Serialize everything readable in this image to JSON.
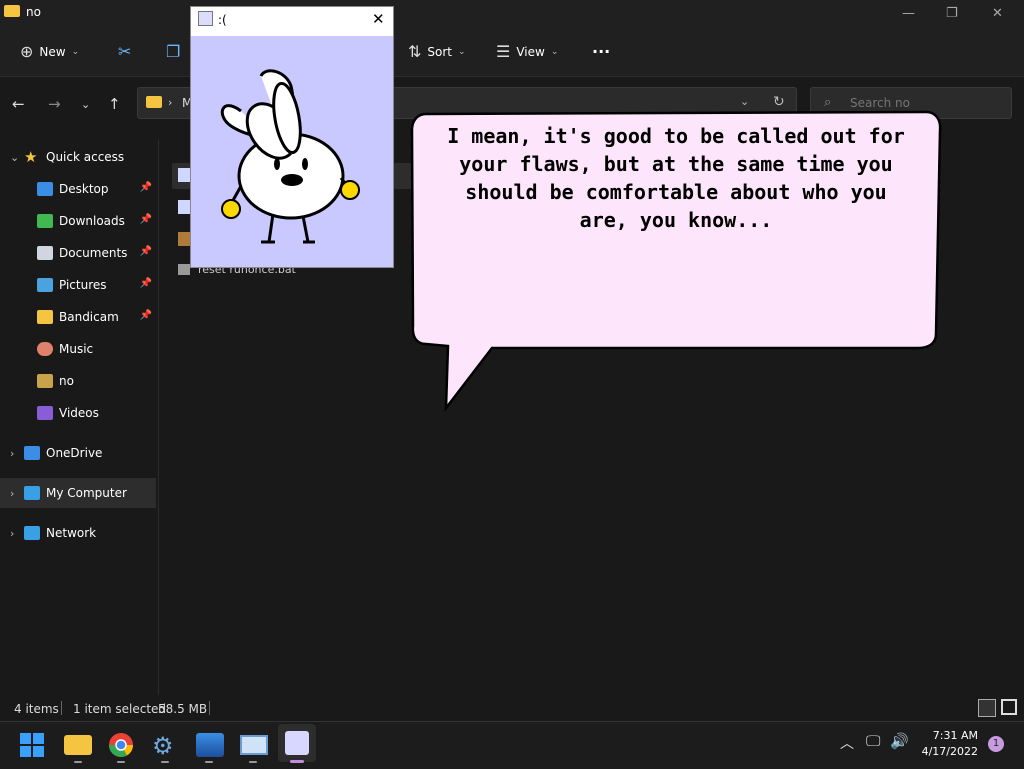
{
  "window": {
    "title": "no",
    "minimize": "—",
    "maximize": "❐",
    "close": "✕"
  },
  "toolbar": {
    "new": "New",
    "sort": "Sort",
    "view": "View",
    "more": "···"
  },
  "address": {
    "path_prefix": "M",
    "search_placeholder": "Search no"
  },
  "sidebar": {
    "items": [
      {
        "label": "Quick access",
        "icon": "star-icon",
        "color": "#f5c542"
      },
      {
        "label": "Desktop",
        "icon": "desktop-icon",
        "color": "#3a8ee6",
        "pinned": true
      },
      {
        "label": "Downloads",
        "icon": "download-icon",
        "color": "#3fb950",
        "pinned": true
      },
      {
        "label": "Documents",
        "icon": "document-icon",
        "color": "#cfd6e0",
        "pinned": true
      },
      {
        "label": "Pictures",
        "icon": "picture-icon",
        "color": "#4aa3df",
        "pinned": true
      },
      {
        "label": "Bandicam",
        "icon": "folder-icon",
        "color": "#f5c542",
        "pinned": true
      },
      {
        "label": "Music",
        "icon": "music-icon",
        "color": "#e0826b"
      },
      {
        "label": "no",
        "icon": "folder-icon",
        "color": "#c9a24a"
      },
      {
        "label": "Videos",
        "icon": "video-icon",
        "color": "#8a5cd6"
      },
      {
        "label": "OneDrive",
        "icon": "cloud-icon",
        "color": "#3a8ee6"
      },
      {
        "label": "My Computer",
        "icon": "computer-icon",
        "color": "#3aa0e6"
      },
      {
        "label": "Network",
        "icon": "network-icon",
        "color": "#3aa0e6"
      }
    ]
  },
  "files": {
    "visible_name": "reset runonce.bat"
  },
  "popup": {
    "title": ":("
  },
  "bubble": {
    "text": "I mean, it's good to be called out for your flaws, but at the same time you should be comfortable about who you are, you know..."
  },
  "status": {
    "items": "4 items",
    "selected": "1 item selected",
    "size": "58.5 MB"
  },
  "taskbar": {
    "time": "7:31 AM",
    "date": "4/17/2022",
    "badge": "1"
  }
}
